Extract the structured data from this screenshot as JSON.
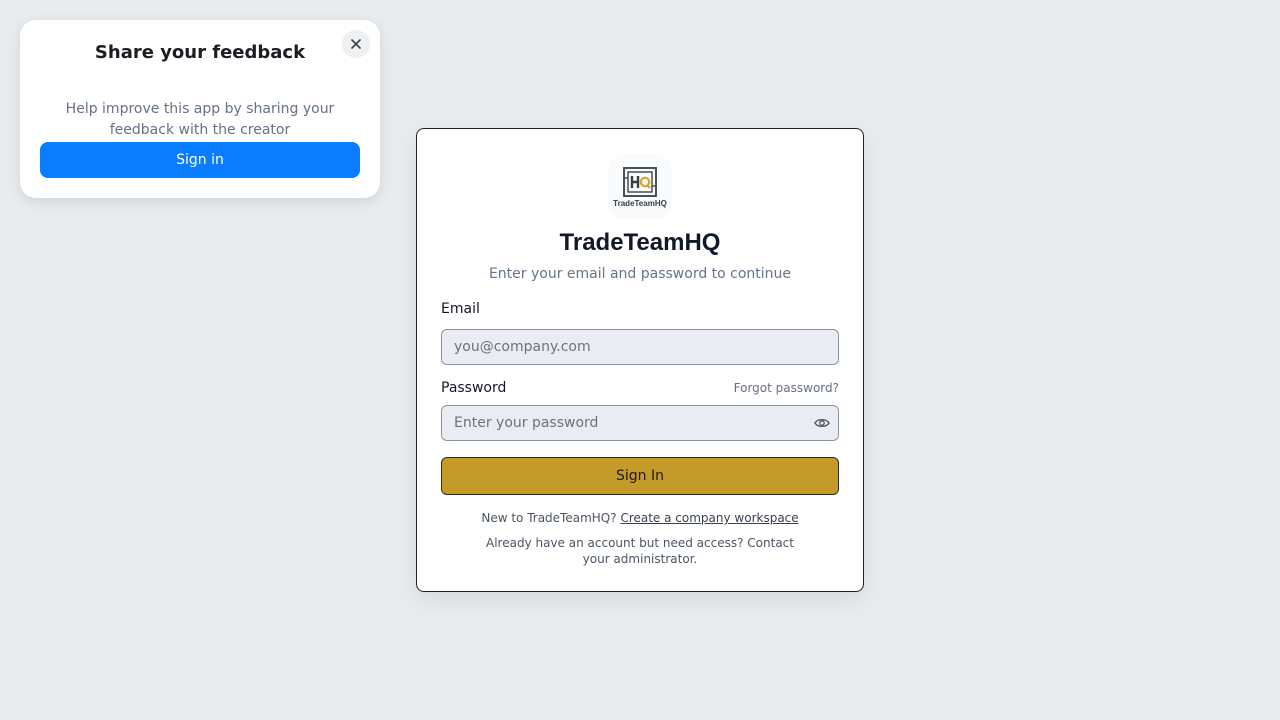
{
  "feedback": {
    "title": "Share your feedback",
    "description": "Help improve this app by sharing your feedback with the creator",
    "button_label": "Sign in",
    "close_icon": "close-icon",
    "button_color": "#0a7cff"
  },
  "login": {
    "logo_text": "HQ",
    "logo_caption": "TradeTeamHQ",
    "title": "TradeTeamHQ",
    "subtitle": "Enter your email and password to continue",
    "email_label": "Email",
    "email_placeholder": "you@company.com",
    "password_label": "Password",
    "forgot_password": "Forgot password?",
    "password_placeholder": "Enter your password",
    "show_password_icon": "eye-icon",
    "submit_label": "Sign In",
    "submit_color": "#c49a28",
    "new_prompt": "New to TradeTeamHQ?",
    "create_link": "Create a company workspace",
    "access_note": "Already have an account but need access? Contact your administrator."
  }
}
